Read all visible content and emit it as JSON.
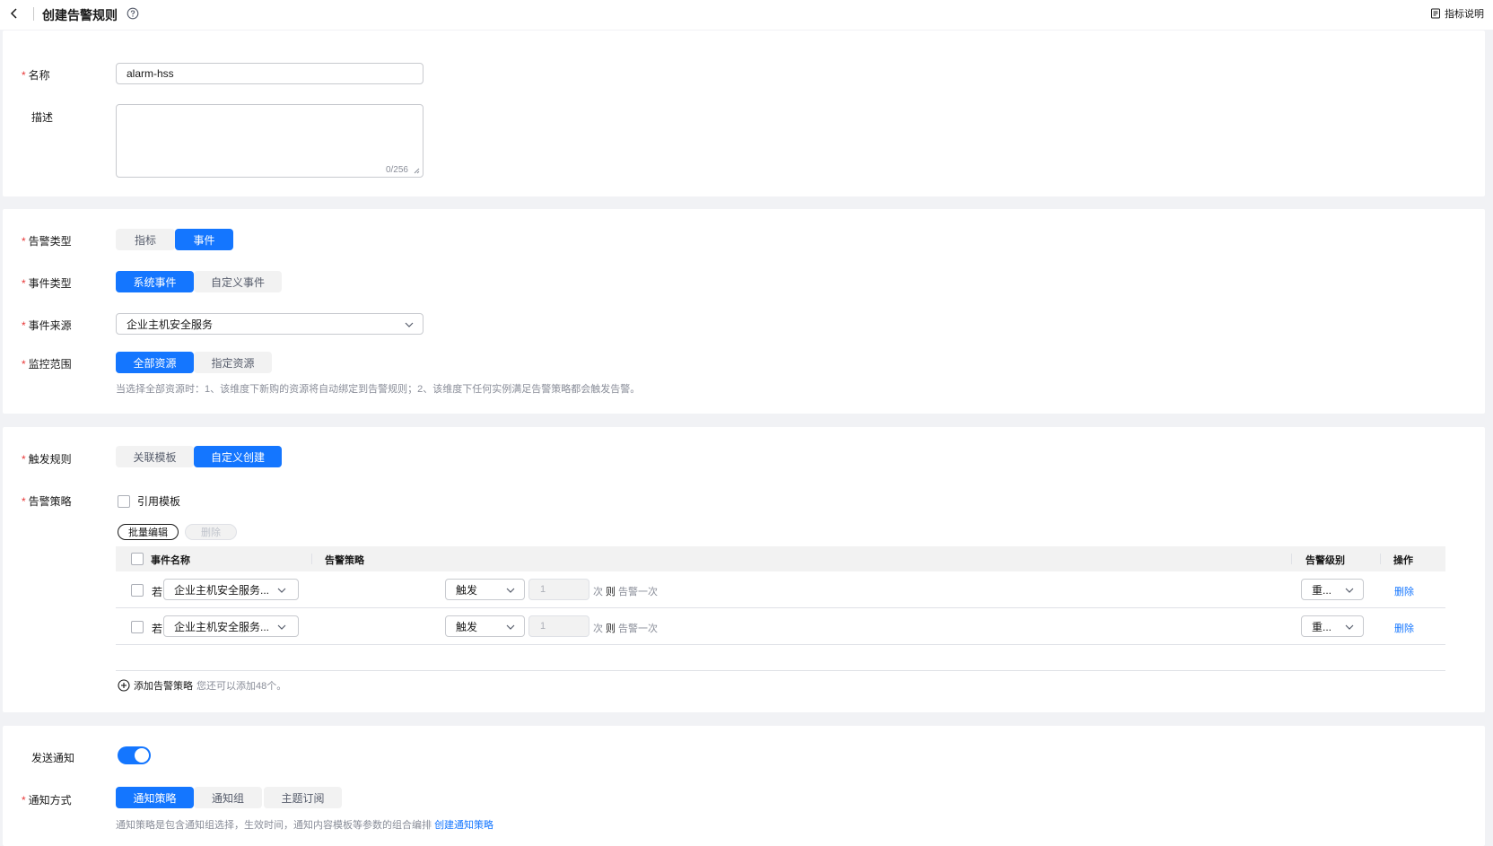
{
  "header": {
    "title": "创建告警规则",
    "doc_link": "指标说明"
  },
  "basic": {
    "name_label": "名称",
    "name_value": "alarm-hss",
    "desc_label": "描述",
    "desc_count": "0/256"
  },
  "alarm": {
    "type_label": "告警类型",
    "type_options": [
      "指标",
      "事件"
    ],
    "event_type_label": "事件类型",
    "event_type_options": [
      "系统事件",
      "自定义事件"
    ],
    "source_label": "事件来源",
    "source_value": "企业主机安全服务",
    "scope_label": "监控范围",
    "scope_options": [
      "全部资源",
      "指定资源"
    ],
    "scope_hint": "当选择全部资源时：1、该维度下新购的资源将自动绑定到告警规则；2、该维度下任何实例满足告警策略都会触发告警。"
  },
  "rules": {
    "trigger_label": "触发规则",
    "trigger_options": [
      "关联模板",
      "自定义创建"
    ],
    "policy_label": "告警策略",
    "use_template": "引用模板",
    "batch_edit": "批量编辑",
    "delete": "删除",
    "columns": {
      "event_name": "事件名称",
      "policy": "告警策略",
      "level": "告警级别",
      "action": "操作"
    },
    "rows": [
      {
        "if": "若",
        "event": "企业主机安全服务...",
        "trigger": "触发",
        "times": "1",
        "times_unit": "次",
        "then": "则",
        "alert_once": "告警一次",
        "level": "重...",
        "action": "删除"
      },
      {
        "if": "若",
        "event": "企业主机安全服务...",
        "trigger": "触发",
        "times": "1",
        "times_unit": "次",
        "then": "则",
        "alert_once": "告警一次",
        "level": "重...",
        "action": "删除"
      }
    ],
    "add_policy": "添加告警策略",
    "add_remaining": "您还可以添加48个。"
  },
  "notify": {
    "send_label": "发送通知",
    "send_on": true,
    "method_label": "通知方式",
    "method_options": [
      "通知策略",
      "通知组",
      "主题订阅"
    ],
    "method_hint": "通知策略是包含通知组选择，生效时间，通知内容模板等参数的组合编排",
    "create_link": "创建通知策略"
  },
  "colors": {
    "primary": "#1476ff",
    "required": "#e83838"
  }
}
